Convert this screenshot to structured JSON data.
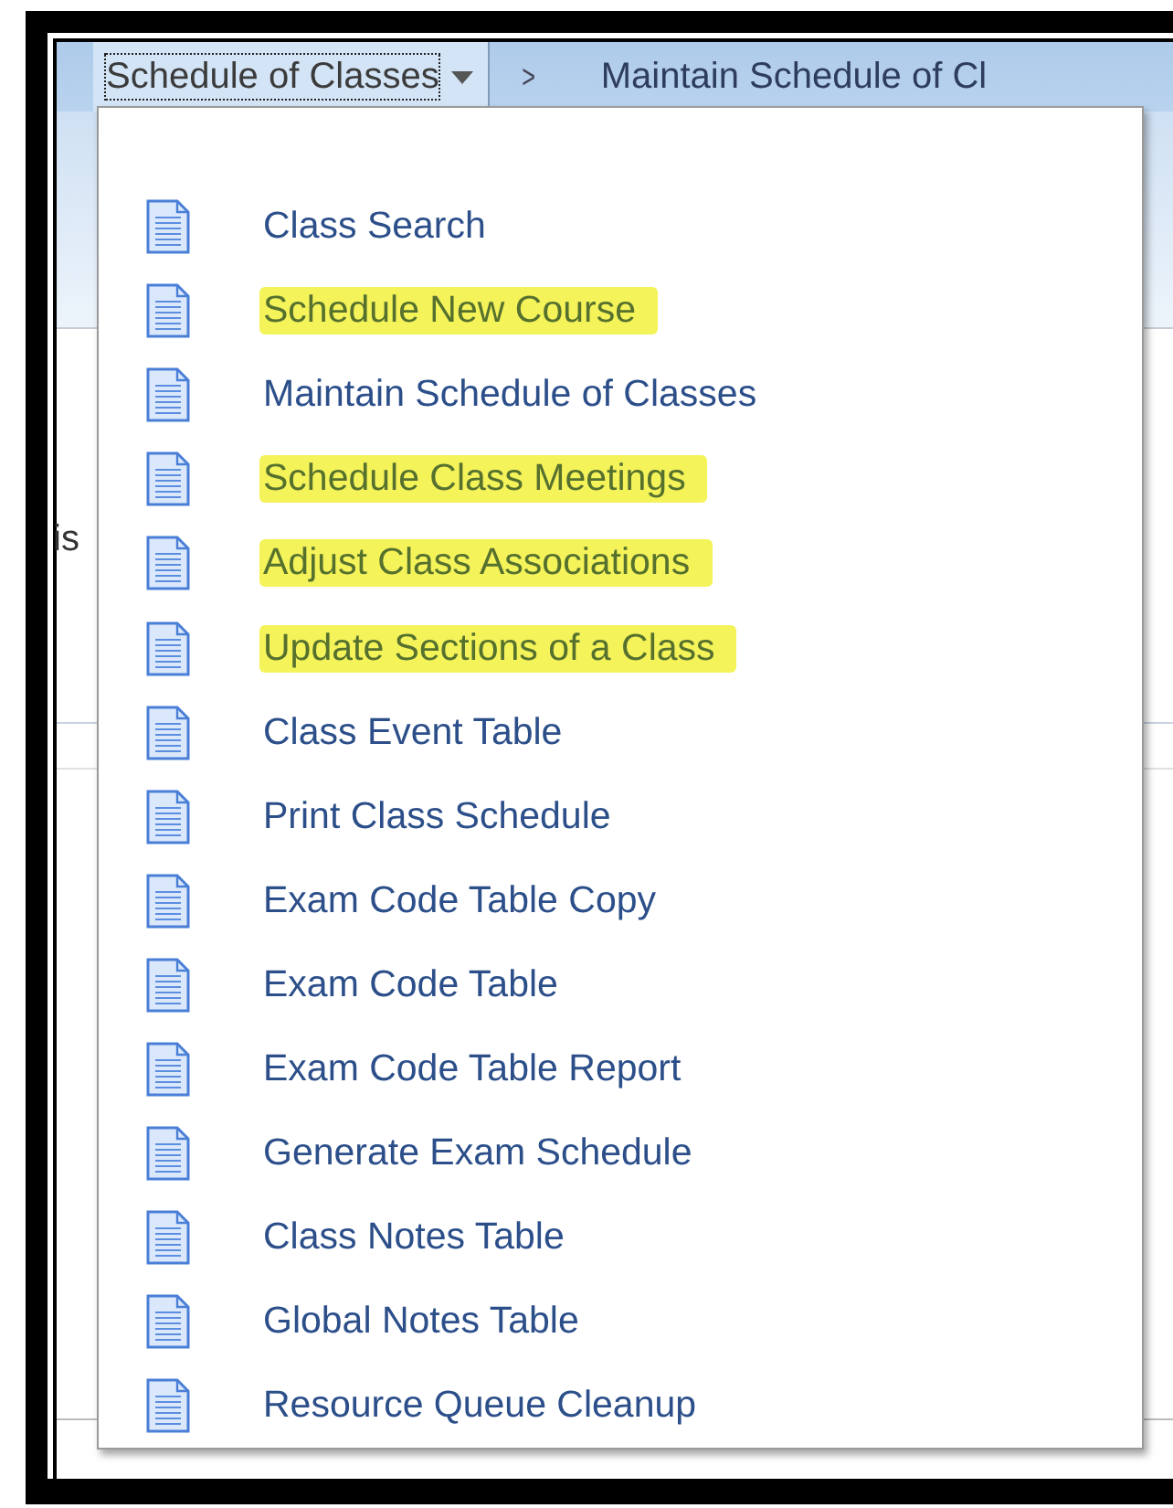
{
  "breadcrumb": {
    "menu_button": {
      "label": "Schedule of Classes",
      "focused": true
    },
    "separator": ">",
    "current": "Maintain Schedule of Cl"
  },
  "background_text": "is",
  "menu": {
    "items": [
      {
        "label": "Class Search",
        "highlighted": false
      },
      {
        "label": "Schedule New Course",
        "highlighted": true
      },
      {
        "label": "Maintain Schedule of Classes",
        "highlighted": false
      },
      {
        "label": "Schedule Class Meetings",
        "highlighted": true
      },
      {
        "label": "Adjust Class Associations",
        "highlighted": true
      },
      {
        "label": "Update Sections of a Class",
        "highlighted": true
      },
      {
        "label": "Class Event Table",
        "highlighted": false
      },
      {
        "label": "Print Class Schedule",
        "highlighted": false
      },
      {
        "label": "Exam Code Table Copy",
        "highlighted": false
      },
      {
        "label": "Exam Code Table",
        "highlighted": false
      },
      {
        "label": "Exam Code Table Report",
        "highlighted": false
      },
      {
        "label": "Generate Exam Schedule",
        "highlighted": false
      },
      {
        "label": "Class Notes Table",
        "highlighted": false
      },
      {
        "label": "Global Notes Table",
        "highlighted": false
      },
      {
        "label": "Resource Queue Cleanup",
        "highlighted": false
      }
    ]
  }
}
